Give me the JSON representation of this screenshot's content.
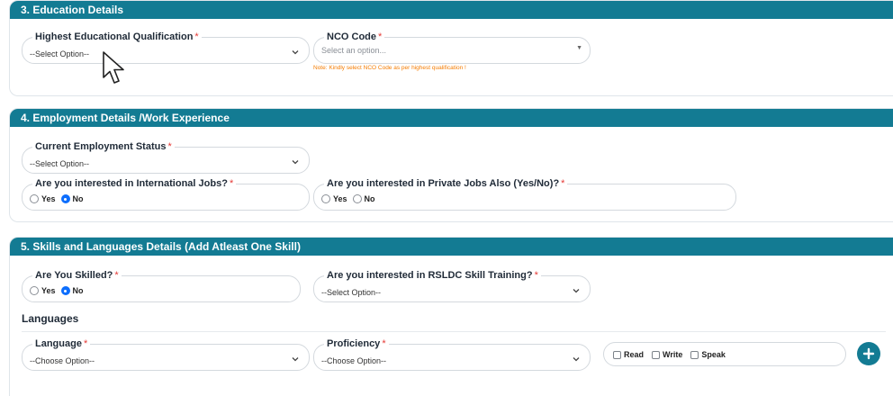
{
  "sections": {
    "education": {
      "title": "3. Education Details",
      "qualification": {
        "label": "Highest Educational Qualification",
        "required": "*",
        "value": "--Select Option--"
      },
      "nco": {
        "label": "NCO Code",
        "required": "*",
        "placeholder": "Select an option...",
        "note": "Note: Kindly select NCO Code as per highest qualification !"
      }
    },
    "employment": {
      "title": "4. Employment Details /Work Experience",
      "status": {
        "label": "Current Employment Status",
        "required": "*",
        "value": "--Select Option--"
      },
      "international": {
        "label": "Are you interested in International Jobs?",
        "required": "*",
        "yes": "Yes",
        "no": "No",
        "selected": "No"
      },
      "private": {
        "label": "Are you interested in Private Jobs Also (Yes/No)?",
        "required": "*",
        "yes": "Yes",
        "no": "No",
        "selected": ""
      }
    },
    "skills": {
      "title": "5. Skills and Languages Details (Add Atleast One Skill)",
      "skilled": {
        "label": "Are You Skilled?",
        "required": "*",
        "yes": "Yes",
        "no": "No",
        "selected": "No"
      },
      "rsldc": {
        "label": "Are you interested in RSLDC Skill Training?",
        "required": "*",
        "value": "--Select Option--"
      },
      "languages_heading": "Languages",
      "language": {
        "label": "Language",
        "required": "*",
        "value": "--Choose Option--"
      },
      "proficiency": {
        "label": "Proficiency",
        "required": "*",
        "value": "--Choose Option--"
      },
      "abilities": {
        "read": "Read",
        "write": "Write",
        "speak": "Speak"
      }
    }
  },
  "colors": {
    "header": "#137b93",
    "accent": "#0d6efd",
    "required": "#e53935",
    "note": "#f57c00"
  },
  "icons": {
    "chevron": "chevron-down-icon",
    "add": "plus-icon",
    "cursor": "mouse-pointer-icon"
  }
}
